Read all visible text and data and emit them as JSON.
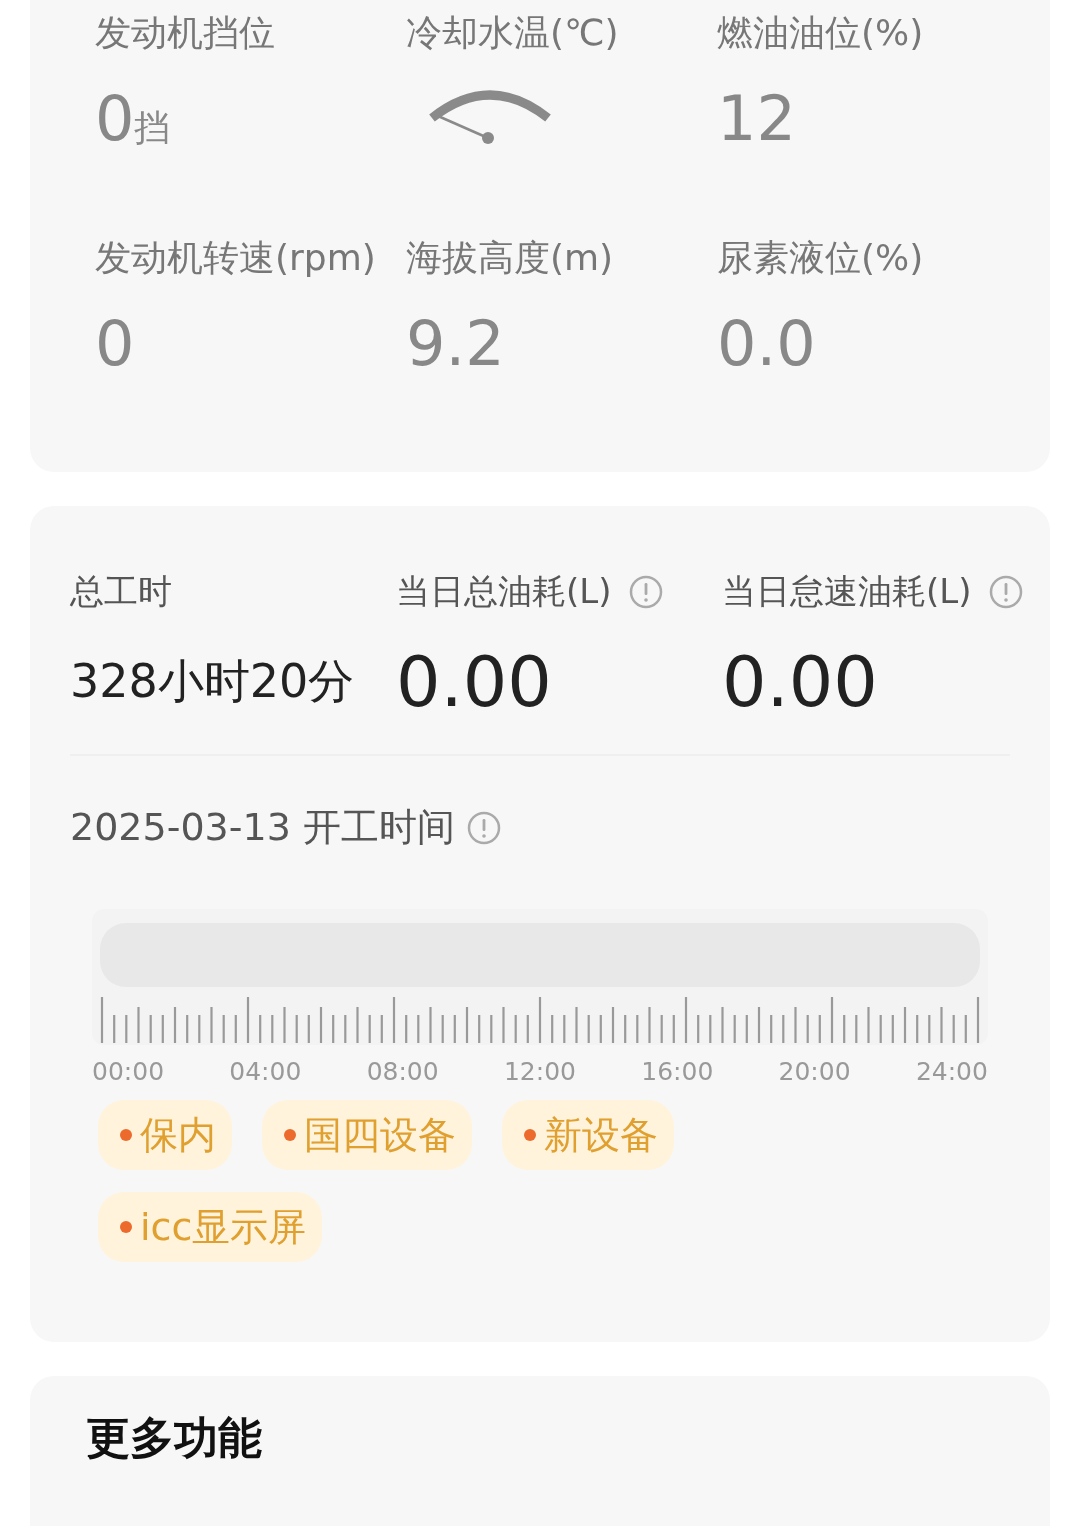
{
  "vehicle_status": {
    "metrics": [
      {
        "kind": "value",
        "label": "发动机挡位",
        "value": "0",
        "unit": "挡"
      },
      {
        "kind": "gauge",
        "label": "冷却水温(℃)"
      },
      {
        "kind": "value",
        "label": "燃油油位(%)",
        "value": "12"
      },
      {
        "kind": "value",
        "label": "发动机转速(rpm)",
        "value": "0"
      },
      {
        "kind": "value",
        "label": "海拔高度(m)",
        "value": "9.2"
      },
      {
        "kind": "value",
        "label": "尿素液位(%)",
        "value": "0.0"
      }
    ]
  },
  "work_summary": {
    "stats": [
      {
        "label": "总工时",
        "value": "328小时20分",
        "info": false
      },
      {
        "label": "当日总油耗(L)",
        "value": "0.00",
        "info": true
      },
      {
        "label": "当日怠速油耗(L)",
        "value": "0.00",
        "info": true
      }
    ],
    "timeline": {
      "title": "2025-03-13 开工时间",
      "time_labels": [
        "00:00",
        "04:00",
        "08:00",
        "12:00",
        "16:00",
        "20:00",
        "24:00"
      ]
    },
    "tags": [
      {
        "text": "保内"
      },
      {
        "text": "国四设备"
      },
      {
        "text": "新设备"
      },
      {
        "text": "icc显示屏"
      }
    ]
  },
  "more": {
    "title": "更多功能"
  }
}
